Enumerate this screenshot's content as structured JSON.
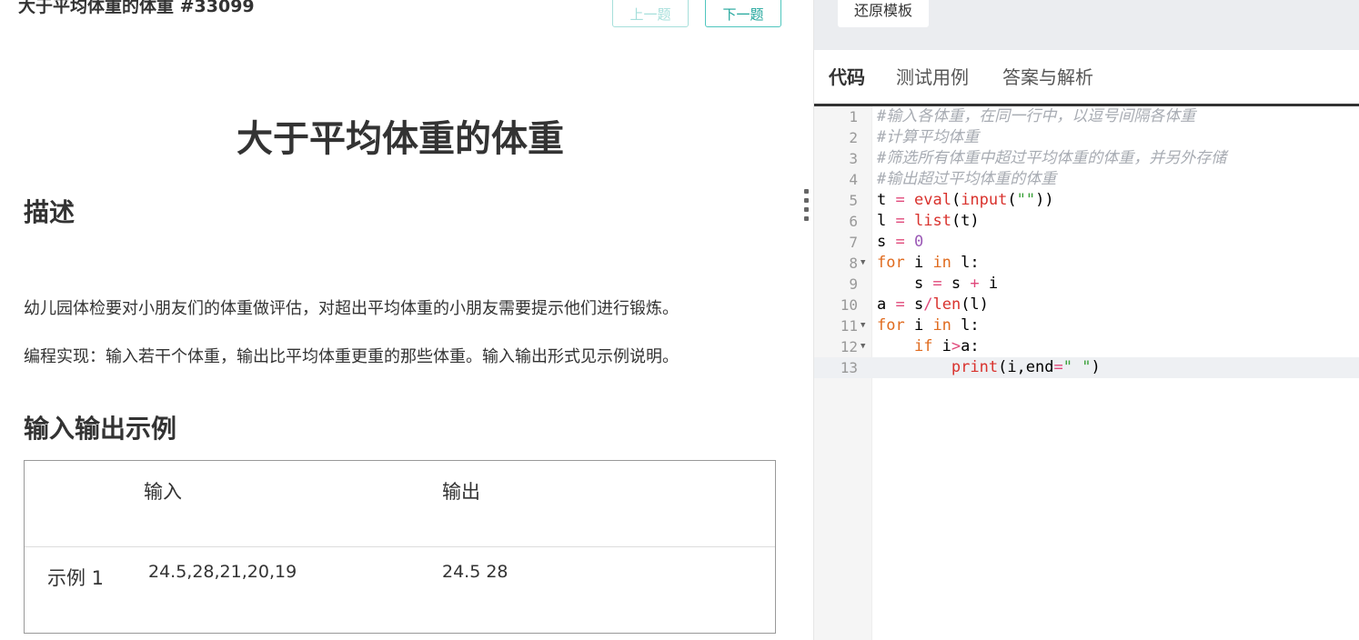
{
  "header": {
    "title": "大于平均体重的体重 #33099",
    "prev_label": "上一题",
    "next_label": "下一题"
  },
  "problem": {
    "heading": "大于平均体重的体重",
    "desc_title": "描述",
    "desc_para1": "幼儿园体检要对小朋友们的体重做评估，对超出平均体重的小朋友需要提示他们进行锻炼。",
    "desc_para2": "编程实现：输入若干个体重，输出比平均体重更重的那些体重。输入输出形式见示例说明。",
    "io_title": "输入输出示例",
    "table": {
      "col_input": "输入",
      "col_output": "输出",
      "rows": [
        {
          "label": "示例 1",
          "input": "24.5,28,21,20,19",
          "output": "24.5 28"
        }
      ]
    }
  },
  "editor_panel": {
    "reset_label": "还原模板",
    "tabs": [
      "代码",
      "测试用例",
      "答案与解析"
    ],
    "active_tab": 0,
    "line_numbers": [
      "1",
      "2",
      "3",
      "4",
      "5",
      "6",
      "7",
      "8",
      "9",
      "10",
      "11",
      "12",
      "13"
    ],
    "comments": [
      "#输入各体重，在同一行中，以逗号间隔各体重",
      "#计算平均体重",
      "#筛选所有体重中超过平均体重的体重，并另外存储",
      "#输出超过平均体重的体重"
    ],
    "code_lines": [
      "t = eval(input(\"\"))",
      "l = list(t)",
      "s = 0",
      "for i in l:",
      "    s = s + i",
      "a = s/len(l)",
      "for i in l:",
      "    if i>a:",
      "        print(i,end=\" \")"
    ]
  }
}
